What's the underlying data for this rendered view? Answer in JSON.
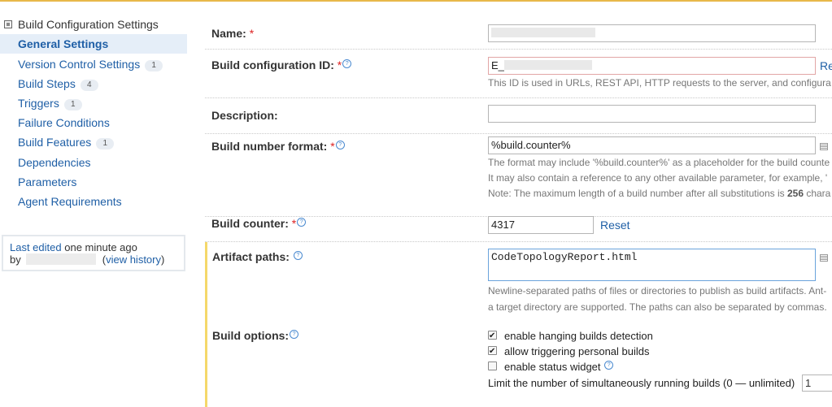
{
  "sidebar": {
    "title": "Build Configuration Settings",
    "items": [
      {
        "label": "General Settings",
        "badge": ""
      },
      {
        "label": "Version Control Settings",
        "badge": "1"
      },
      {
        "label": "Build Steps",
        "badge": "4"
      },
      {
        "label": "Triggers",
        "badge": "1"
      },
      {
        "label": "Failure Conditions",
        "badge": ""
      },
      {
        "label": "Build Features",
        "badge": "1"
      },
      {
        "label": "Dependencies",
        "badge": ""
      },
      {
        "label": "Parameters",
        "badge": ""
      },
      {
        "label": "Agent Requirements",
        "badge": ""
      }
    ],
    "last_edited": {
      "prefix": "Last edited",
      "time": "one minute ago",
      "by": "by",
      "history_open": "(",
      "history_link": "view history",
      "history_close": ")"
    }
  },
  "form": {
    "name": {
      "label": "Name:",
      "req": "*"
    },
    "build_id": {
      "label": "Build configuration ID:",
      "req": "*",
      "value_prefix": "E_",
      "note": "This ID is used in URLs, REST API, HTTP requests to the server, and configura",
      "regenerate": "Re"
    },
    "description": {
      "label": "Description:"
    },
    "build_number": {
      "label": "Build number format:",
      "req": "*",
      "value": "%build.counter%",
      "note1": "The format may include '%build.counter%' as a placeholder for the build counte",
      "note2": "It may also contain a reference to any other available parameter, for example, '",
      "note3_a": "Note: The maximum length of a build number after all substitutions is ",
      "note3_b": "256",
      "note3_c": " chara"
    },
    "build_counter": {
      "label": "Build counter:",
      "req": "*",
      "value": "4317",
      "reset": "Reset"
    },
    "artifact_paths": {
      "label": "Artifact paths:",
      "value": "CodeTopologyReport.html",
      "note1": "Newline-separated paths of files or directories to publish as build artifacts. Ant-",
      "note2": "a target directory are supported. The paths can also be separated by commas."
    },
    "build_options": {
      "label": "Build options:",
      "opt1": {
        "label": "enable hanging builds detection",
        "checked": true
      },
      "opt2": {
        "label": "allow triggering personal builds",
        "checked": true
      },
      "opt3": {
        "label": "enable status widget",
        "checked": false
      },
      "limit_label": "Limit the number of simultaneously running builds (0 — unlimited)",
      "limit_value": "1"
    }
  },
  "help_glyph": "?"
}
